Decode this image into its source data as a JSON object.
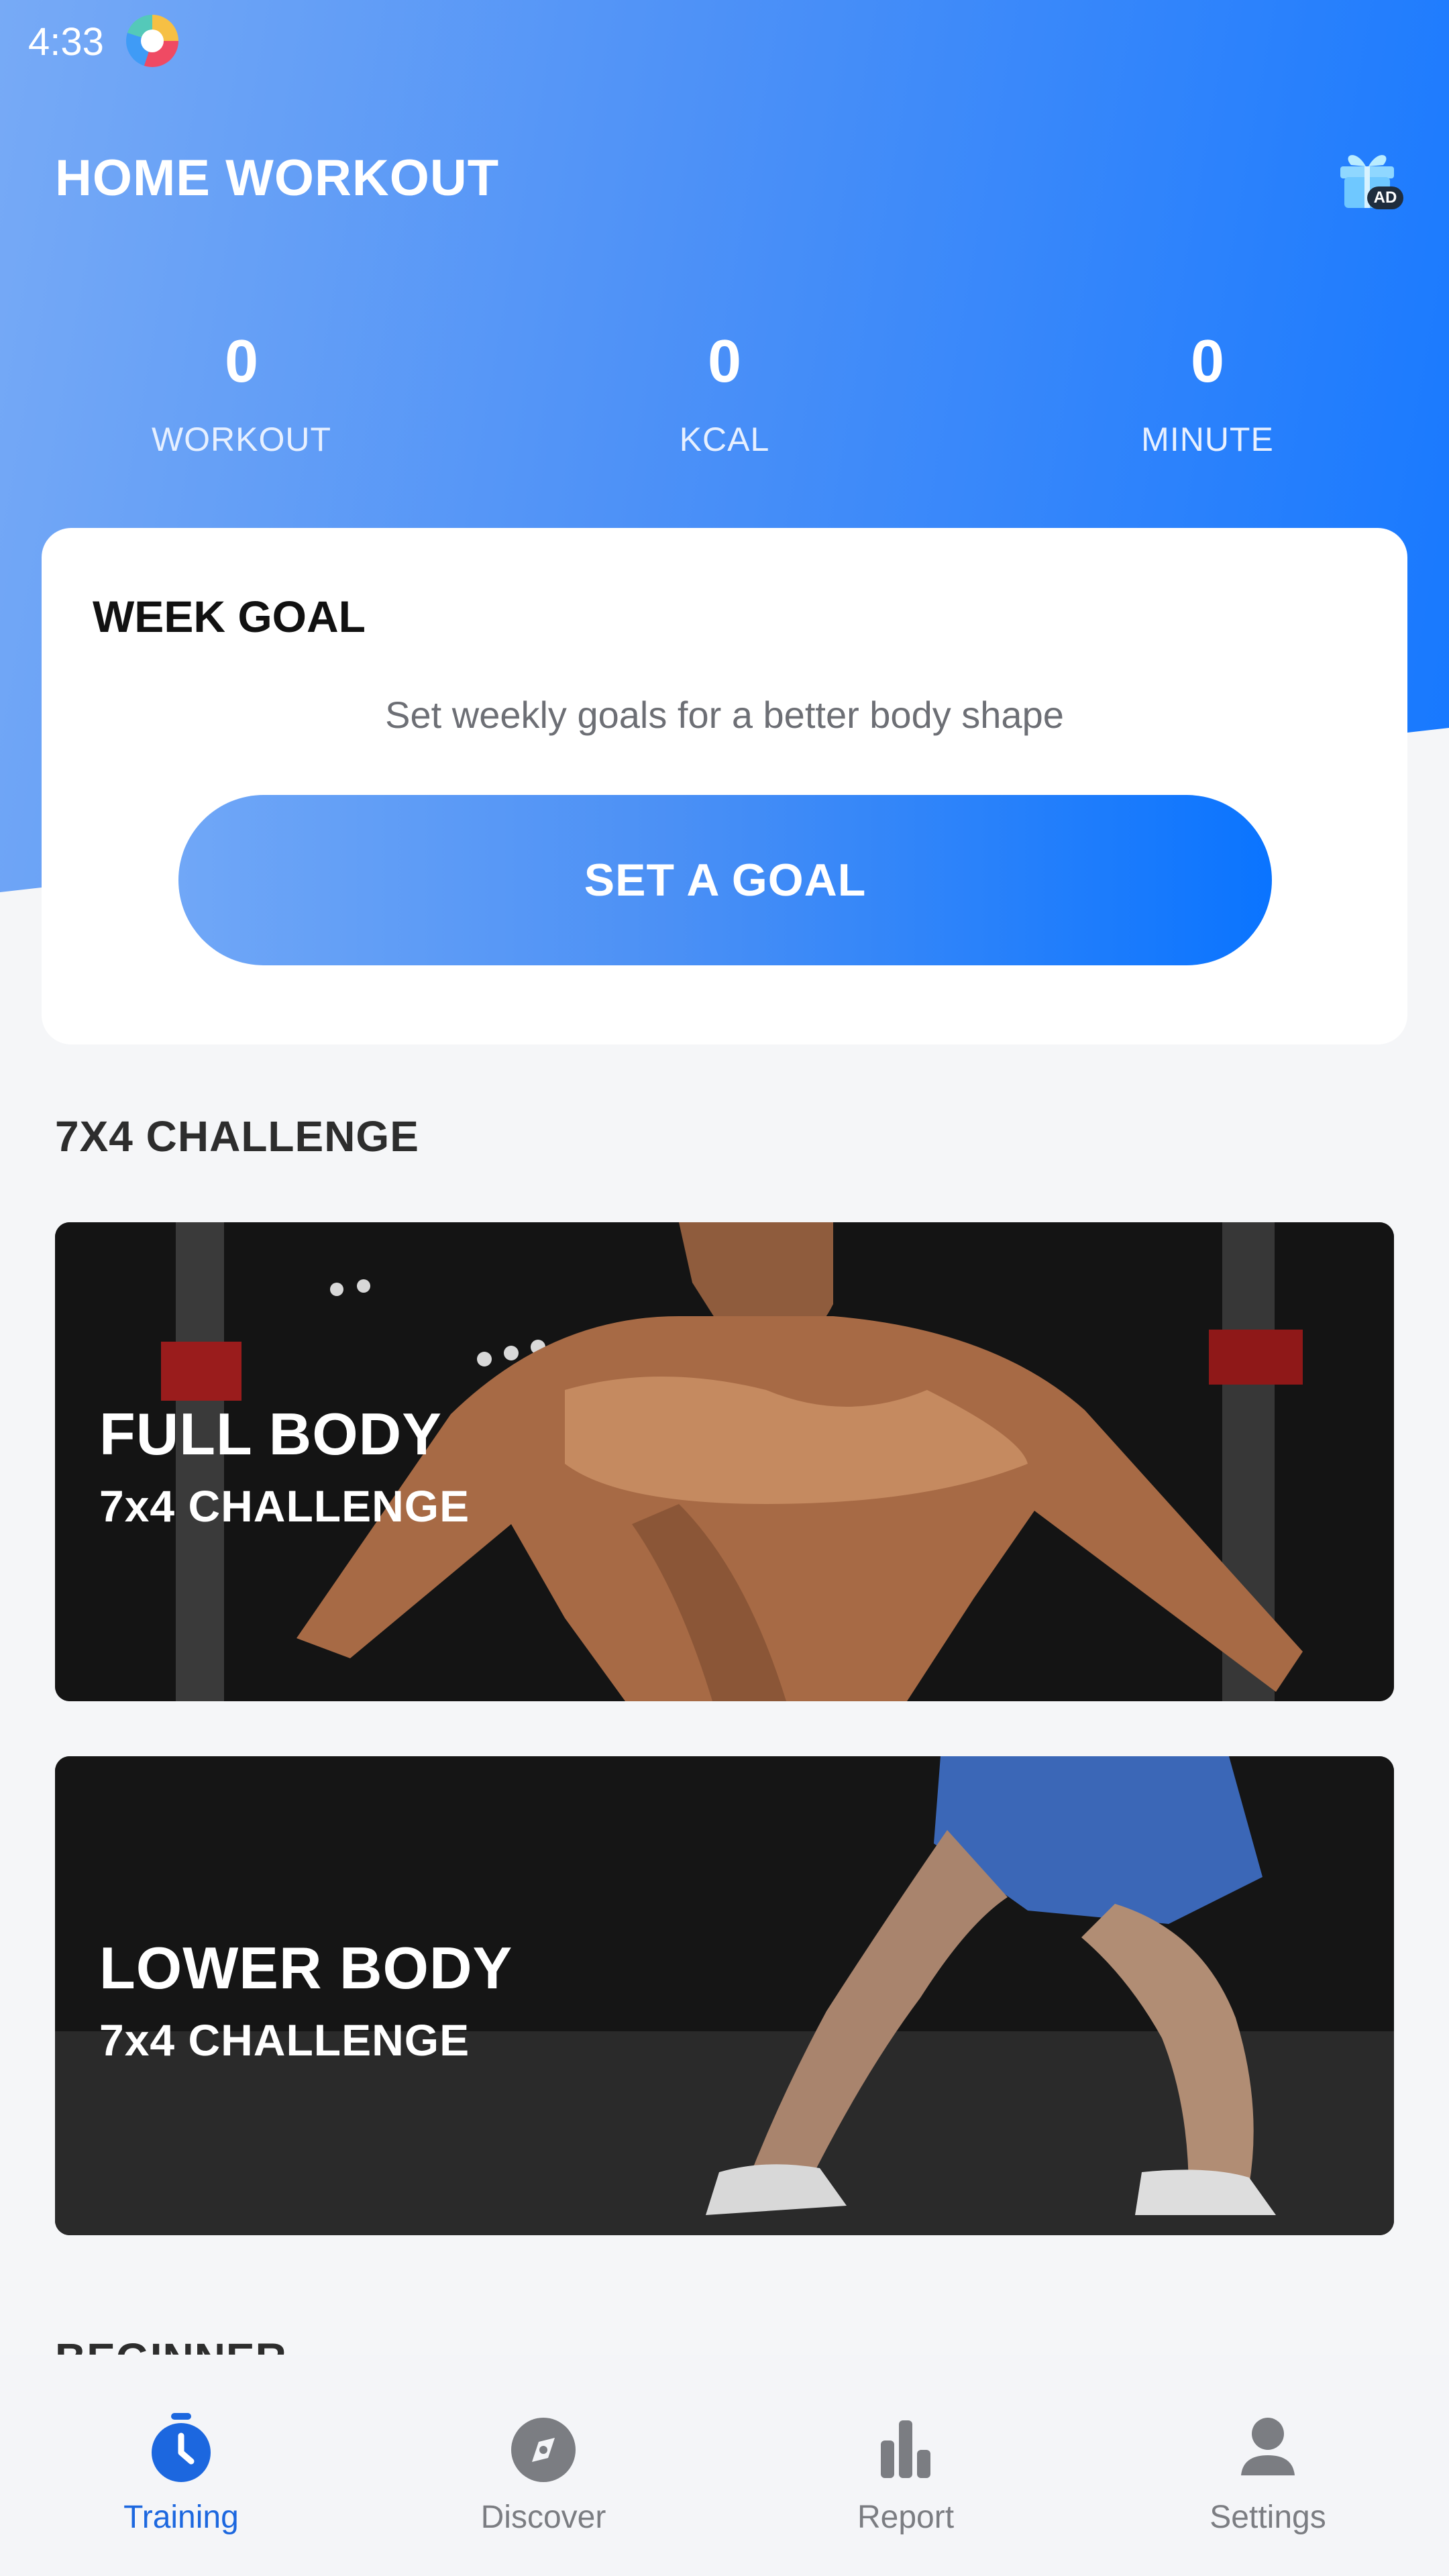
{
  "status_bar": {
    "time": "4:33"
  },
  "header": {
    "title": "HOME WORKOUT",
    "ad_badge": "AD",
    "gift_icon": "gift-icon"
  },
  "stats": [
    {
      "value": "0",
      "label": "WORKOUT"
    },
    {
      "value": "0",
      "label": "KCAL"
    },
    {
      "value": "0",
      "label": "MINUTE"
    }
  ],
  "week_goal": {
    "title": "WEEK GOAL",
    "subtitle": "Set weekly goals for a better body shape",
    "button_label": "SET A GOAL"
  },
  "challenge_section": {
    "title": "7X4 CHALLENGE",
    "cards": [
      {
        "title": "FULL BODY",
        "subtitle": "7x4 CHALLENGE"
      },
      {
        "title": "LOWER BODY",
        "subtitle": "7x4 CHALLENGE"
      }
    ]
  },
  "next_section": {
    "title": "BEGINNER"
  },
  "bottom_nav": {
    "items": [
      {
        "label": "Training",
        "icon": "stopwatch-icon",
        "active": true
      },
      {
        "label": "Discover",
        "icon": "compass-icon",
        "active": false
      },
      {
        "label": "Report",
        "icon": "bar-chart-icon",
        "active": false
      },
      {
        "label": "Settings",
        "icon": "person-icon",
        "active": false
      }
    ]
  },
  "colors": {
    "primary_blue": "#1678ff",
    "light_blue": "#77aaf6",
    "active_nav": "#1c67df",
    "background": "#f5f6f8"
  }
}
